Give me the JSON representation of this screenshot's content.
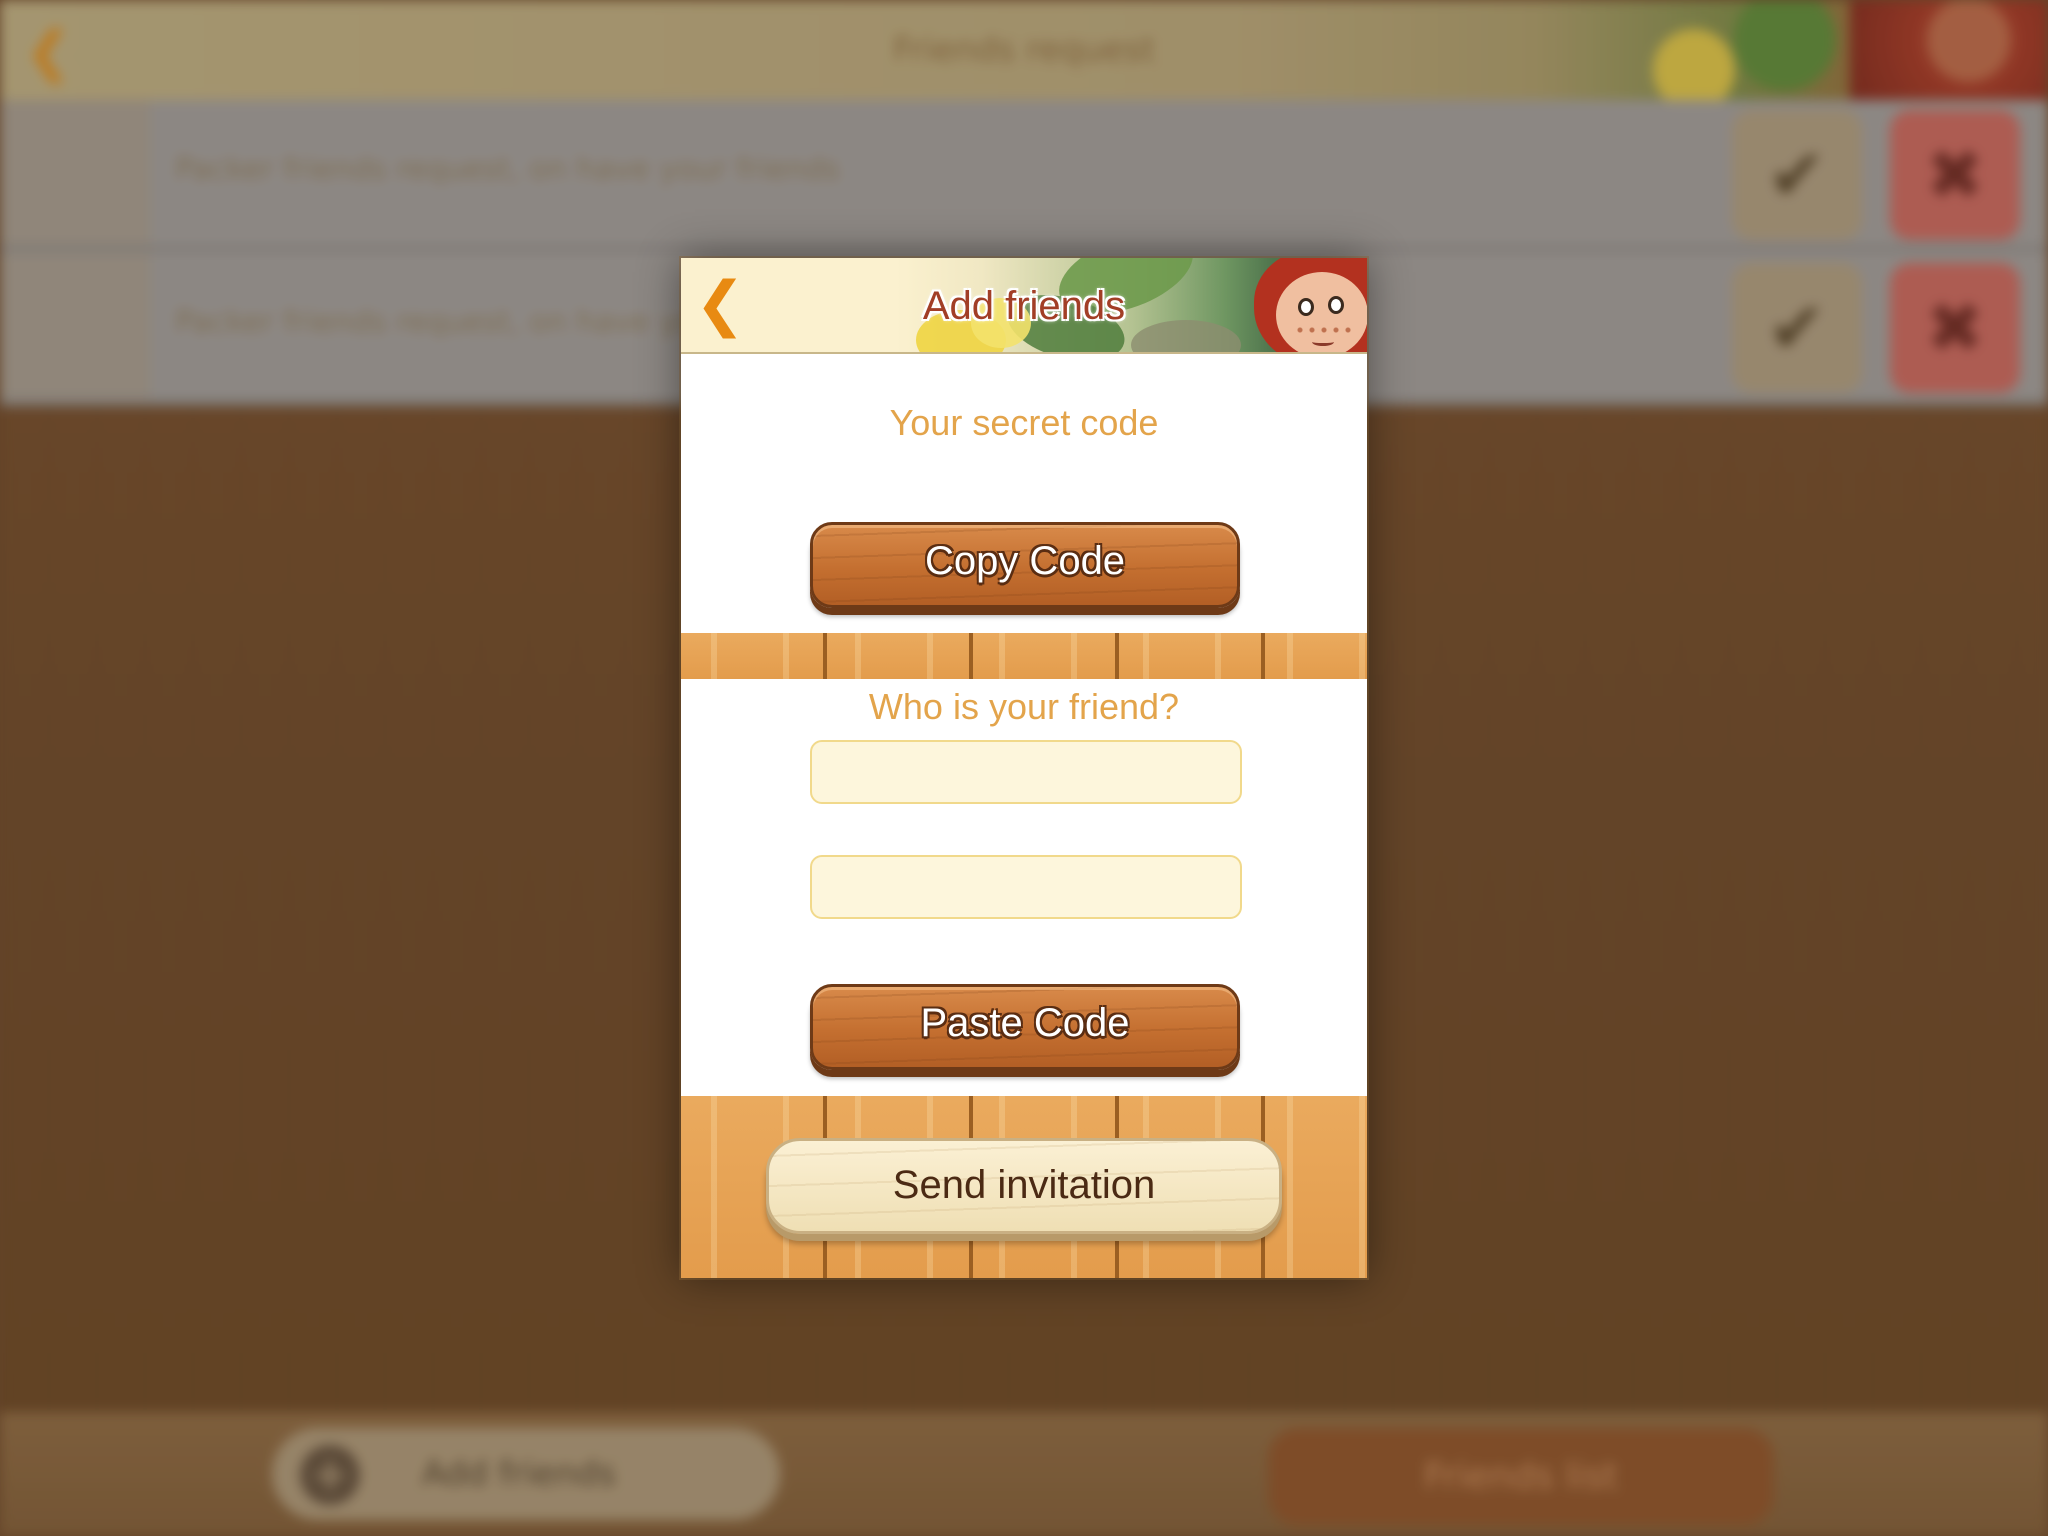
{
  "background": {
    "header_title": "Friends request",
    "rows": [
      {
        "text": "Packer friends request, on have your friends"
      },
      {
        "text": "Packer friends request, on have your"
      }
    ],
    "footer_add_label": "Add friends",
    "footer_right_label": "Friends list"
  },
  "modal": {
    "title": "Add friends",
    "back_icon": "chevron-left-icon",
    "secret_code_label": "Your secret code",
    "copy_button_label": "Copy Code",
    "friend_label": "Who is your friend?",
    "friend_name_field": {
      "value": "",
      "placeholder": ""
    },
    "friend_code_field": {
      "value": "",
      "placeholder": ""
    },
    "paste_button_label": "Paste Code",
    "send_button_label": "Send invitation"
  },
  "colors": {
    "accent_orange": "#e88a12",
    "label_gold": "#e3a44b",
    "title_red": "#a23e26",
    "wood_brown": "#c46f30"
  }
}
